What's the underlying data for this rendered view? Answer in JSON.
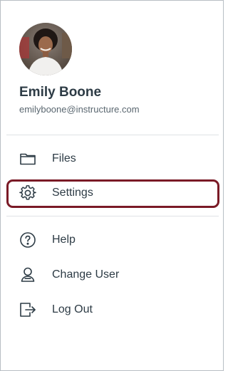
{
  "profile": {
    "name": "Emily Boone",
    "email": "emilyboone@instructure.com"
  },
  "menu": {
    "primary": [
      {
        "label": "Files",
        "icon": "folder-icon"
      },
      {
        "label": "Settings",
        "icon": "gear-icon"
      }
    ],
    "secondary": [
      {
        "label": "Help",
        "icon": "help-circle-icon"
      },
      {
        "label": "Change User",
        "icon": "user-switch-icon"
      },
      {
        "label": "Log Out",
        "icon": "logout-icon"
      }
    ]
  },
  "colors": {
    "text": "#2d3b45",
    "highlight": "#7a1a26",
    "divider": "#dfe2e5"
  }
}
